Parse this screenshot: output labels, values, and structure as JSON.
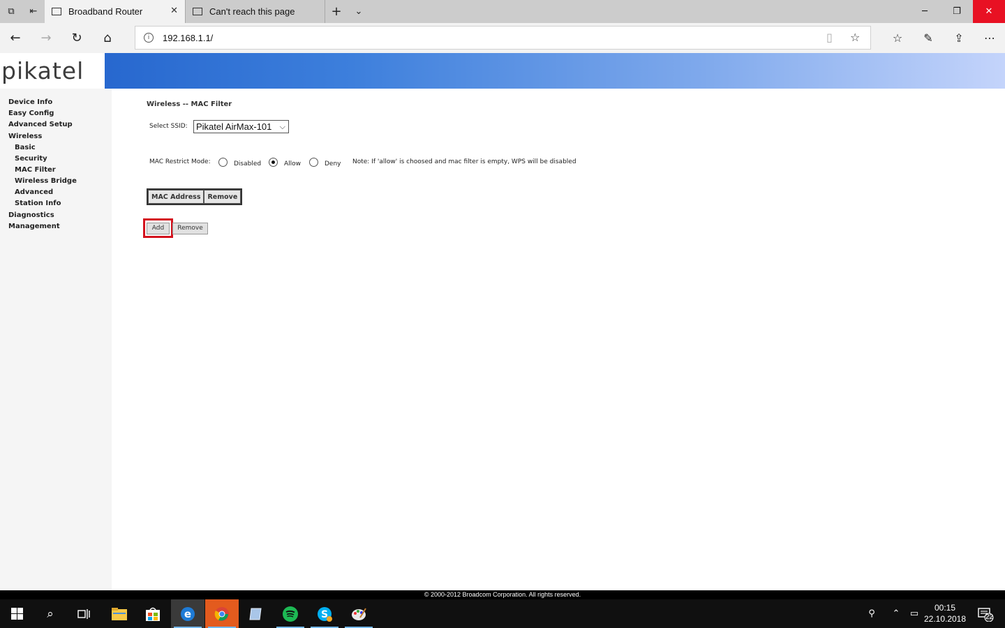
{
  "browser": {
    "tabs": [
      {
        "title": "Broadband Router",
        "active": true
      },
      {
        "title": "Can't reach this page",
        "active": false
      }
    ],
    "url": "192.168.1.1/"
  },
  "page": {
    "logo": "pikatel",
    "menu": [
      {
        "label": "Device Info",
        "level": 0
      },
      {
        "label": "Easy Config",
        "level": 0
      },
      {
        "label": "Advanced Setup",
        "level": 0
      },
      {
        "label": "Wireless",
        "level": 0
      },
      {
        "label": "Basic",
        "level": 1
      },
      {
        "label": "Security",
        "level": 1
      },
      {
        "label": "MAC Filter",
        "level": 1
      },
      {
        "label": "Wireless Bridge",
        "level": 1
      },
      {
        "label": "Advanced",
        "level": 1
      },
      {
        "label": "Station Info",
        "level": 1
      },
      {
        "label": "Diagnostics",
        "level": 0
      },
      {
        "label": "Management",
        "level": 0
      }
    ],
    "title": "Wireless -- MAC Filter",
    "select_ssid_label": "Select SSID:",
    "ssid_value": "Pikatel AirMax-101",
    "restrict_mode_label": "MAC Restrict Mode:",
    "modes": [
      "Disabled",
      "Allow",
      "Deny"
    ],
    "selected_mode": "Allow",
    "note": "Note: If 'allow' is choosed and mac filter is empty, WPS will be disabled",
    "table_headers": [
      "MAC Address",
      "Remove"
    ],
    "add_button": "Add",
    "remove_button": "Remove",
    "footer": "© 2000-2012 Broadcom Corporation. All rights reserved."
  },
  "taskbar": {
    "time": "00:15",
    "date": "22.10.2018",
    "notifications": "22"
  },
  "colors": {
    "banner_start": "#1e5ec9",
    "banner_end": "#c4d4fb",
    "highlight": "#d4131e",
    "close_button": "#e81123"
  }
}
